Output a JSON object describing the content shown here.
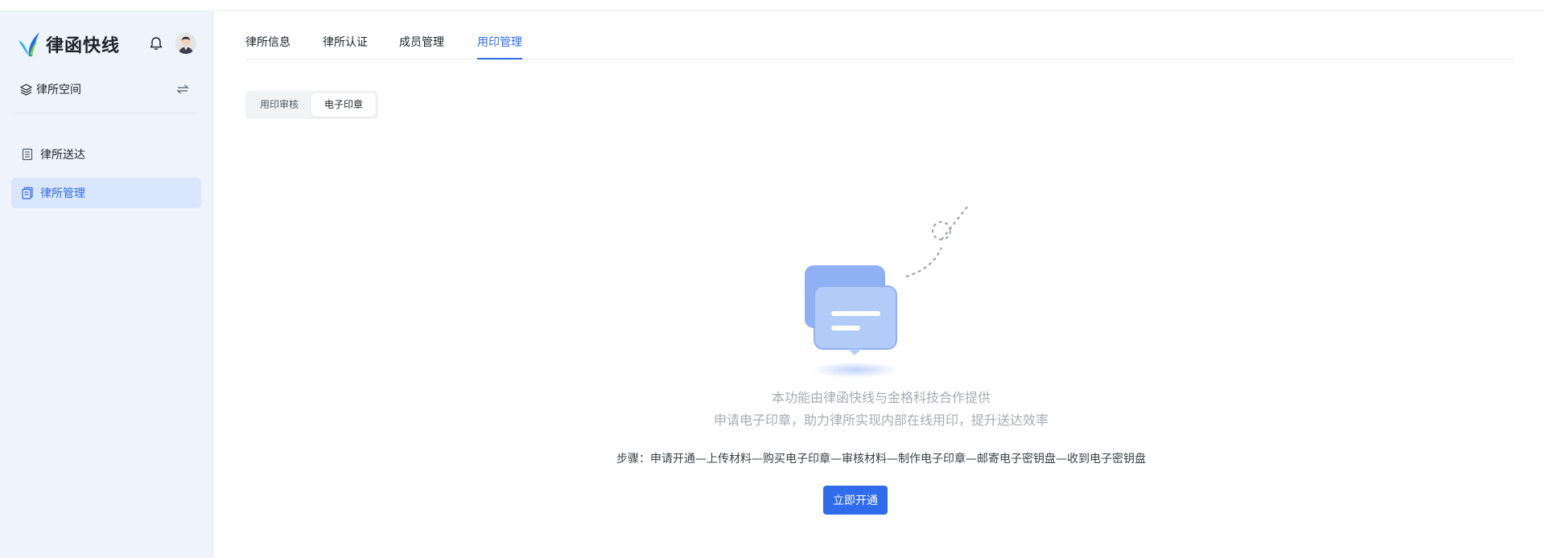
{
  "brand": {
    "name": "律函快线",
    "logo_icon": "leaf-logo-icon"
  },
  "header_icons": {
    "notification": "bell-icon",
    "profile": "avatar"
  },
  "sidebar": {
    "space": {
      "label": "律所空间",
      "icon": "layers-icon",
      "switch_icon": "swap-icon"
    },
    "items": [
      {
        "label": "律所送达",
        "icon": "document-icon",
        "active": false
      },
      {
        "label": "律所管理",
        "icon": "manage-doc-icon",
        "active": true
      }
    ]
  },
  "tabs": [
    {
      "label": "律所信息",
      "active": false
    },
    {
      "label": "律所认证",
      "active": false
    },
    {
      "label": "成员管理",
      "active": false
    },
    {
      "label": "用印管理",
      "active": true
    }
  ],
  "segments": [
    {
      "label": "用印审核",
      "active": false
    },
    {
      "label": "电子印章",
      "active": true
    }
  ],
  "empty_state": {
    "illustration": "chat-bubbles-illustration",
    "line1": "本功能由律函快线与金格科技合作提供",
    "line2": "申请电子印章，助力律所实现内部在线用印，提升送达效率",
    "steps": "步骤：申请开通—上传材料—购买电子印章—审核材料—制作电子印章—邮寄电子密钥盘—收到电子密钥盘",
    "button_label": "立即开通"
  },
  "colors": {
    "accent": "#2f6bea",
    "sidebar_bg": "#eff4fc",
    "sidebar_active_bg": "#d9e6fd",
    "muted_text": "#a8abb2"
  }
}
